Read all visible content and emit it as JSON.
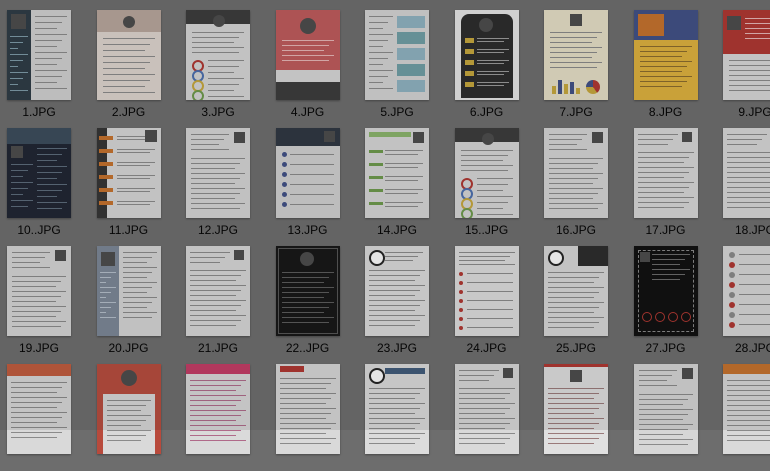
{
  "files": [
    {
      "name": "1.JPG",
      "style": "dark-left"
    },
    {
      "name": "2.JPG",
      "style": "light-photo-top"
    },
    {
      "name": "3.JPG",
      "style": "white-header-circles"
    },
    {
      "name": "4.JPG",
      "style": "red-block"
    },
    {
      "name": "5.JPG",
      "style": "boxes-right"
    },
    {
      "name": "6.JPG",
      "style": "black-panel"
    },
    {
      "name": "7.JPG",
      "style": "beige-bars"
    },
    {
      "name": "8.JPG",
      "style": "orange-blue"
    },
    {
      "name": "9.JPG",
      "style": "red-top"
    },
    {
      "name": "10..JPG",
      "style": "dark-full"
    },
    {
      "name": "11.JPG",
      "style": "orange-timeline"
    },
    {
      "name": "12.JPG",
      "style": "plain-photo"
    },
    {
      "name": "13.JPG",
      "style": "dark-header-icons"
    },
    {
      "name": "14.JPG",
      "style": "green-bars"
    },
    {
      "name": "15..JPG",
      "style": "white-header-circles"
    },
    {
      "name": "16.JPG",
      "style": "plain-photo"
    },
    {
      "name": "17.JPG",
      "style": "plain-lines"
    },
    {
      "name": "18.JPG",
      "style": "plain-lines"
    },
    {
      "name": "19.JPG",
      "style": "plain-photo"
    },
    {
      "name": "20.JPG",
      "style": "blue-left"
    },
    {
      "name": "21.JPG",
      "style": "plain-lines"
    },
    {
      "name": "22..JPG",
      "style": "black-frame"
    },
    {
      "name": "23.JPG",
      "style": "panda"
    },
    {
      "name": "24.JPG",
      "style": "red-icons"
    },
    {
      "name": "25.JPG",
      "style": "dark-corner"
    },
    {
      "name": "27.JPG",
      "style": "black-red-circles"
    },
    {
      "name": "28.JPG",
      "style": "red-dots"
    },
    {
      "name": "",
      "style": "red-orange-top"
    },
    {
      "name": "",
      "style": "red-card"
    },
    {
      "name": "",
      "style": "pink-top"
    },
    {
      "name": "",
      "style": "red-label-top"
    },
    {
      "name": "",
      "style": "panda-blue"
    },
    {
      "name": "",
      "style": "plain-lines"
    },
    {
      "name": "",
      "style": "red-line-top"
    },
    {
      "name": "",
      "style": "plain-photo"
    },
    {
      "name": "",
      "style": "orange-top"
    }
  ],
  "colors": {
    "background": "#6d6d6d",
    "accent_red": "#b0352f",
    "accent_orange": "#c7712b",
    "accent_blue": "#3f4f86",
    "accent_green": "#6d9a4a",
    "accent_yellow": "#c8a83b"
  }
}
